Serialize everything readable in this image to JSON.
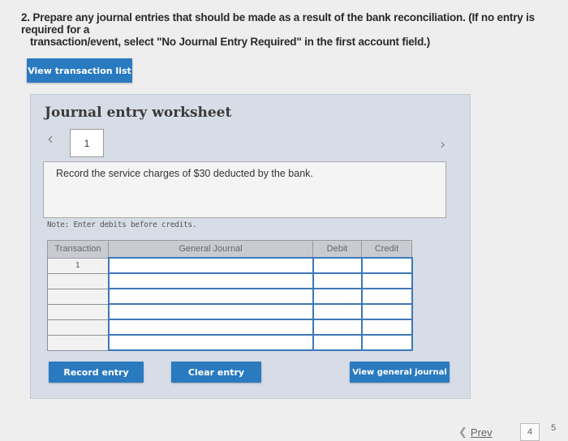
{
  "instructions": {
    "line1": "2. Prepare any journal entries that should be made as a result of the bank reconciliation. (If no entry is required for a",
    "line2": "transaction/event, select \"No Journal Entry Required\" in the first account field.)"
  },
  "view_transaction_list_label": "View transaction list",
  "worksheet": {
    "title": "Journal entry worksheet",
    "prev_icon": "chevron-left-icon",
    "next_icon": "chevron-right-icon",
    "current_page": "1",
    "description": "Record the service charges of $30 deducted by the bank.",
    "note": "Note: Enter debits before credits.",
    "table": {
      "headers": [
        "Transaction",
        "General Journal",
        "Debit",
        "Credit"
      ],
      "rows": [
        [
          "1",
          "",
          "",
          ""
        ],
        [
          "",
          "",
          "",
          ""
        ],
        [
          "",
          "",
          "",
          ""
        ],
        [
          "",
          "",
          "",
          ""
        ],
        [
          "",
          "",
          "",
          ""
        ],
        [
          "",
          "",
          "",
          ""
        ]
      ]
    },
    "buttons": {
      "record": "Record entry",
      "clear": "Clear entry",
      "view_journal": "View general journal"
    }
  },
  "pager": {
    "prev_label": "Prev",
    "current": "4",
    "next_partial": "5"
  },
  "colors": {
    "button_blue": "#2a7ac0",
    "panel_bg": "#d7dde6",
    "entry_border": "#3d78b8"
  }
}
